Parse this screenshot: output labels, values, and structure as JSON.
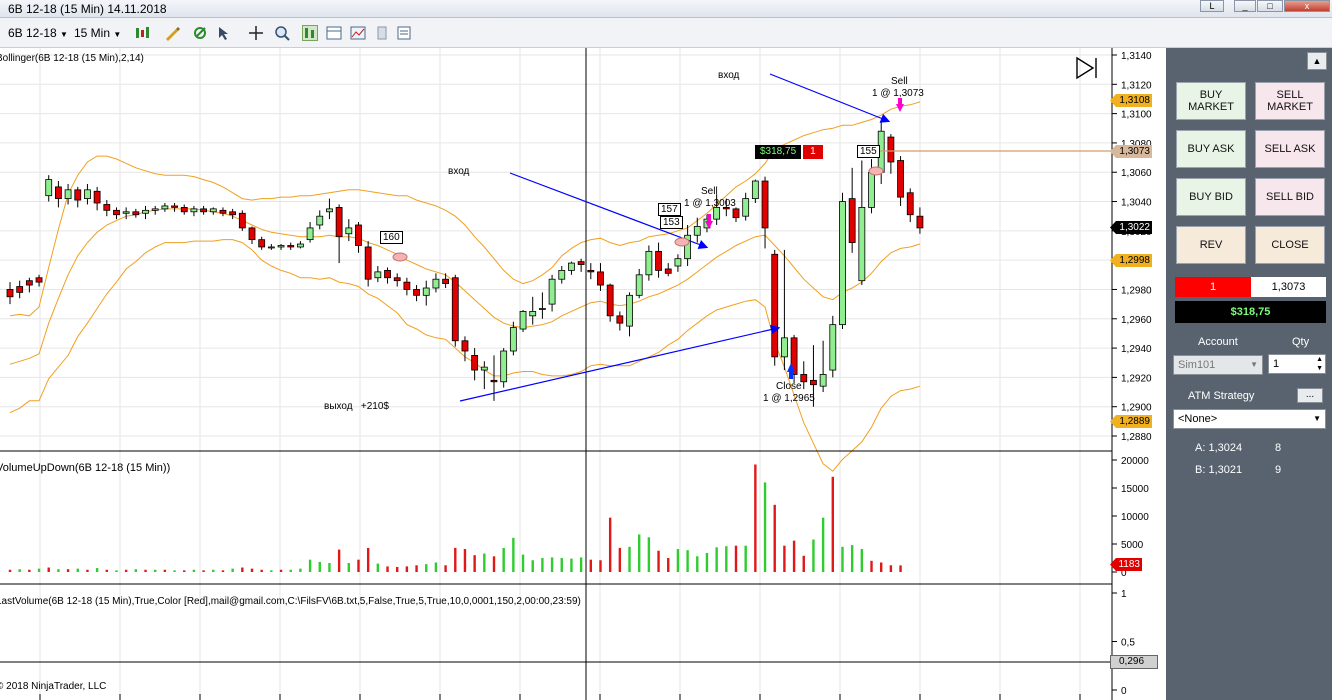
{
  "window": {
    "title": "6B 12-18 (15 Min)  14.11.2018",
    "min_label": "_",
    "max_label": "□",
    "close_label": "x",
    "link_label": "L"
  },
  "toolbar": {
    "instrument": "6B 12-18",
    "interval": "15 Min",
    "icons": [
      "candlestick-icon",
      "pencil-icon",
      "draw-tool-icon",
      "cursor-icon",
      "crosshair-icon",
      "zoom-icon",
      "chart-trader-icon",
      "data-box-icon",
      "properties-icon",
      "template-icon"
    ]
  },
  "chart": {
    "price_labels": [
      "1,3140",
      "1,3120",
      "1,3100",
      "1,3080",
      "1,3060",
      "1,3040",
      "1,3020",
      "1,2980",
      "1,2960",
      "1,2940",
      "1,2920",
      "1,2900",
      "1,2880"
    ],
    "badges": {
      "p1": "1,3108",
      "p2": "1,3073",
      "p3": "1,3022",
      "p4": "1,2998",
      "p5": "1,2889"
    },
    "indicator_label": "Bollinger(6B 12-18 (15 Min),2,14)",
    "volume_label": "VolumeUpDown(6B 12-18 (15 Min))",
    "volume_ticks": [
      "20000",
      "15000",
      "10000",
      "5000",
      "0"
    ],
    "volume_badge": "1183",
    "last_volume_label": "LastVolume(6B 12-18 (15 Min),True,Color [Red],mail@gmail.com,C:\\FilsFV\\6B.txt,5,False,True,5,True,10,0,0001,150,2,00:00,23:59)",
    "lv_ticks": [
      "1",
      "0,5",
      "0"
    ],
    "lv_badge": "0,296",
    "copyright": "© 2018 NinjaTrader, LLC",
    "position_pnl": "$318,75",
    "position_qty": "1",
    "marker_155": "155",
    "marker_157": "157",
    "marker_153": "153",
    "marker_160": "160",
    "annotation_vhod_1": "вход",
    "annotation_vhod_2": "вход",
    "annotation_vyhod": "выход   +210$",
    "sell_1_title": "Sell",
    "sell_1_detail": "1 @ 1,3073",
    "sell_2_title": "Sell",
    "sell_2_detail": "1 @ 1,3003",
    "close_title": "Close",
    "close_detail": "1 @ 1,2965"
  },
  "chart_data": {
    "type": "candlestick",
    "price_axis": {
      "min": 1.288,
      "max": 1.314
    },
    "candles": [
      [
        1.298,
        1.2975,
        1.2985,
        1.297
      ],
      [
        1.2982,
        1.2978,
        1.2986,
        1.2974
      ],
      [
        1.2986,
        1.2983,
        1.2988,
        1.2978
      ],
      [
        1.2988,
        1.2985,
        1.299,
        1.2982
      ],
      [
        1.3044,
        1.3055,
        1.3058,
        1.304
      ],
      [
        1.305,
        1.3042,
        1.3054,
        1.3036
      ],
      [
        1.3042,
        1.3048,
        1.3052,
        1.3038
      ],
      [
        1.3048,
        1.3041,
        1.305,
        1.3036
      ],
      [
        1.3042,
        1.3048,
        1.3052,
        1.3038
      ],
      [
        1.3047,
        1.3039,
        1.305,
        1.3034
      ],
      [
        1.3038,
        1.3034,
        1.3041,
        1.303
      ],
      [
        1.3034,
        1.3031,
        1.3036,
        1.3028
      ],
      [
        1.3032,
        1.3033,
        1.3036,
        1.3028
      ],
      [
        1.3033,
        1.3031,
        1.3035,
        1.3029
      ],
      [
        1.3032,
        1.3034,
        1.3037,
        1.3028
      ],
      [
        1.3034,
        1.3035,
        1.3037,
        1.3031
      ],
      [
        1.3035,
        1.3037,
        1.3039,
        1.3033
      ],
      [
        1.3037,
        1.3036,
        1.3039,
        1.3033
      ],
      [
        1.3036,
        1.3033,
        1.3038,
        1.3031
      ],
      [
        1.3033,
        1.3035,
        1.3037,
        1.303
      ],
      [
        1.3035,
        1.3033,
        1.3037,
        1.3031
      ],
      [
        1.3033,
        1.3035,
        1.3036,
        1.3031
      ],
      [
        1.3034,
        1.3032,
        1.3036,
        1.303
      ],
      [
        1.3033,
        1.3031,
        1.3035,
        1.3028
      ],
      [
        1.3032,
        1.3022,
        1.3034,
        1.302
      ],
      [
        1.3022,
        1.3014,
        1.3023,
        1.3011
      ],
      [
        1.3014,
        1.3009,
        1.3016,
        1.3007
      ],
      [
        1.3009,
        1.3009,
        1.3011,
        1.3007
      ],
      [
        1.3009,
        1.301,
        1.3011,
        1.3007
      ],
      [
        1.301,
        1.3009,
        1.3012,
        1.3007
      ],
      [
        1.3009,
        1.3011,
        1.3013,
        1.3008
      ],
      [
        1.3014,
        1.3022,
        1.3026,
        1.3012
      ],
      [
        1.3024,
        1.303,
        1.3034,
        1.3021
      ],
      [
        1.3033,
        1.3035,
        1.3042,
        1.3028
      ],
      [
        1.3036,
        1.3016,
        1.3038,
        1.2998
      ],
      [
        1.3018,
        1.3022,
        1.3028,
        1.3013
      ],
      [
        1.3024,
        1.301,
        1.3026,
        1.3005
      ],
      [
        1.3009,
        1.2987,
        1.3013,
        1.2982
      ],
      [
        1.2988,
        1.2992,
        1.2996,
        1.2985
      ],
      [
        1.2993,
        1.2988,
        1.2995,
        1.2984
      ],
      [
        1.2988,
        1.2986,
        1.2991,
        1.2982
      ],
      [
        1.2985,
        1.298,
        1.2988,
        1.2976
      ],
      [
        1.298,
        1.2976,
        1.2983,
        1.2972
      ],
      [
        1.2976,
        1.2981,
        1.2986,
        1.2969
      ],
      [
        1.2981,
        1.2987,
        1.2991,
        1.2978
      ],
      [
        1.2987,
        1.2984,
        1.2991,
        1.2981
      ],
      [
        1.2988,
        1.2945,
        1.299,
        1.2941
      ],
      [
        1.2945,
        1.2938,
        1.2948,
        1.2931
      ],
      [
        1.2935,
        1.2925,
        1.294,
        1.2918
      ],
      [
        1.2925,
        1.2927,
        1.2931,
        1.2912
      ],
      [
        1.2918,
        1.2917,
        1.2935,
        1.2904
      ],
      [
        1.2917,
        1.2938,
        1.294,
        1.2913
      ],
      [
        1.2938,
        1.2954,
        1.2958,
        1.2935
      ],
      [
        1.2953,
        1.2965,
        1.2966,
        1.2951
      ],
      [
        1.2962,
        1.2965,
        1.2975,
        1.2956
      ],
      [
        1.2967,
        1.2967,
        1.2978,
        1.296
      ],
      [
        1.297,
        1.2987,
        1.299,
        1.2965
      ],
      [
        1.2987,
        1.2993,
        1.2996,
        1.2984
      ],
      [
        1.2993,
        1.2998,
        1.2999,
        1.299
      ],
      [
        1.2999,
        1.2997,
        1.3001,
        1.2992
      ],
      [
        1.2993,
        1.2992,
        1.2998,
        1.2987
      ],
      [
        1.2992,
        1.2983,
        1.2998,
        1.2979
      ],
      [
        1.2983,
        1.2962,
        1.2984,
        1.2958
      ],
      [
        1.2962,
        1.2957,
        1.2965,
        1.2952
      ],
      [
        1.2955,
        1.2976,
        1.2978,
        1.2948
      ],
      [
        1.2976,
        1.299,
        1.2994,
        1.2974
      ],
      [
        1.299,
        1.3006,
        1.301,
        1.2986
      ],
      [
        1.3006,
        1.2993,
        1.3012,
        1.2988
      ],
      [
        1.2994,
        1.2991,
        1.2998,
        1.2989
      ],
      [
        1.2996,
        1.3001,
        1.3004,
        1.2992
      ],
      [
        1.3001,
        1.3017,
        1.3024,
        1.2996
      ],
      [
        1.3017,
        1.3023,
        1.3029,
        1.3012
      ],
      [
        1.3022,
        1.3028,
        1.3031,
        1.3019
      ],
      [
        1.3028,
        1.3036,
        1.3045,
        1.3024
      ],
      [
        1.3036,
        1.3035,
        1.3042,
        1.303
      ],
      [
        1.3035,
        1.3029,
        1.3036,
        1.3026
      ],
      [
        1.303,
        1.3042,
        1.3046,
        1.3027
      ],
      [
        1.3042,
        1.3054,
        1.3055,
        1.3039
      ],
      [
        1.3054,
        1.3022,
        1.3057,
        1.3008
      ],
      [
        1.3004,
        1.2934,
        1.3007,
        1.2928
      ],
      [
        1.2934,
        1.2947,
        1.3007,
        1.2925
      ],
      [
        1.2947,
        1.2922,
        1.2949,
        1.2916
      ],
      [
        1.2922,
        1.2917,
        1.2931,
        1.2912
      ],
      [
        1.2918,
        1.2915,
        1.2942,
        1.29
      ],
      [
        1.2914,
        1.2922,
        1.2945,
        1.291
      ],
      [
        1.2925,
        1.2956,
        1.2962,
        1.292
      ],
      [
        1.2956,
        1.304,
        1.3046,
        1.2953
      ],
      [
        1.3042,
        1.3012,
        1.3063,
        1.3005
      ],
      [
        1.2986,
        1.3036,
        1.3068,
        1.2983
      ],
      [
        1.3036,
        1.306,
        1.3069,
        1.3032
      ],
      [
        1.306,
        1.3088,
        1.3095,
        1.3052
      ],
      [
        1.3084,
        1.3067,
        1.3086,
        1.3059
      ],
      [
        1.3068,
        1.3043,
        1.3071,
        1.3037
      ],
      [
        1.3046,
        1.3031,
        1.3049,
        1.3026
      ],
      [
        1.303,
        1.3022,
        1.3036,
        1.3018
      ]
    ],
    "bollinger_upper": [
      1.2962,
      1.2963,
      1.2962,
      1.2968,
      1.2995,
      1.3021,
      1.3045,
      1.3058,
      1.3067,
      1.3071,
      1.3071,
      1.3069,
      1.3066,
      1.3063,
      1.3061,
      1.3059,
      1.3058,
      1.3058,
      1.3058,
      1.3057,
      1.3055,
      1.3053,
      1.305,
      1.3046,
      1.3042,
      1.3041,
      1.3042,
      1.3042,
      1.3043,
      1.3043,
      1.3044,
      1.3044,
      1.3045,
      1.3046,
      1.3047,
      1.3048,
      1.3048,
      1.3047,
      1.3046,
      1.3045,
      1.3044,
      1.3044,
      1.3041,
      1.3039,
      1.3037,
      1.3034,
      1.303,
      1.3024,
      1.3016,
      1.3009,
      1.3001,
      1.2993,
      1.2987,
      1.2984,
      1.2986,
      1.299,
      1.2995,
      1.3003,
      1.3008,
      1.3012,
      1.3014,
      1.3015,
      1.3012,
      1.301,
      1.3012,
      1.3013,
      1.3016,
      1.3017,
      1.3018,
      1.302,
      1.3022,
      1.3027,
      1.3032,
      1.3038,
      1.3044,
      1.305,
      1.3054,
      1.3059,
      1.3066,
      1.3076,
      1.3079,
      1.3082,
      1.3085,
      1.3087,
      1.3089,
      1.309,
      1.3092,
      1.3092,
      1.3094,
      1.3096,
      1.3099,
      1.3103,
      1.3105,
      1.3106,
      1.3108
    ],
    "bollinger_mid": [
      1.2929,
      1.2931,
      1.2933,
      1.2936,
      1.2957,
      1.2974,
      1.299,
      1.3003,
      1.3012,
      1.3019,
      1.3024,
      1.3027,
      1.303,
      1.3031,
      1.3033,
      1.3034,
      1.3035,
      1.3035,
      1.3035,
      1.3035,
      1.3034,
      1.3033,
      1.3032,
      1.303,
      1.3027,
      1.3024,
      1.3021,
      1.3019,
      1.3018,
      1.3017,
      1.3016,
      1.3016,
      1.3016,
      1.3017,
      1.3016,
      1.3016,
      1.3015,
      1.3012,
      1.301,
      1.3007,
      1.3004,
      1.3,
      1.2997,
      1.2994,
      1.2992,
      1.299,
      1.2985,
      1.2979,
      1.2973,
      1.2967,
      1.2961,
      1.2957,
      1.2955,
      1.2954,
      1.2955,
      1.2956,
      1.2958,
      1.2962,
      1.2965,
      1.2968,
      1.2971,
      1.2972,
      1.297,
      1.2969,
      1.297,
      1.2972,
      1.2975,
      1.2977,
      1.298,
      1.2983,
      1.2987,
      1.2992,
      1.2997,
      1.3002,
      1.3006,
      1.301,
      1.3013,
      1.3016,
      1.3017,
      1.301,
      1.3003,
      1.2995,
      1.2987,
      1.2981,
      1.2975,
      1.2973,
      1.2978,
      1.2981,
      1.2985,
      1.2991,
      1.2999,
      1.3005,
      1.3008,
      1.3009,
      1.3011
    ],
    "bollinger_lower": [
      1.2896,
      1.2899,
      1.2904,
      1.2904,
      1.2919,
      1.2927,
      1.2935,
      1.2948,
      1.2957,
      1.2967,
      1.2977,
      1.2985,
      1.2994,
      1.2999,
      1.3005,
      1.3009,
      1.3012,
      1.3012,
      1.3012,
      1.3013,
      1.3013,
      1.3013,
      1.3014,
      1.3014,
      1.3012,
      1.3007,
      1.3,
      1.2996,
      1.2993,
      1.2991,
      1.2988,
      1.2988,
      1.2987,
      1.2988,
      1.2985,
      1.2984,
      1.2982,
      1.2977,
      1.2974,
      1.2969,
      1.2964,
      1.2956,
      1.2953,
      1.2949,
      1.2947,
      1.2946,
      1.294,
      1.2934,
      1.293,
      1.2925,
      1.2921,
      1.2921,
      1.2923,
      1.2924,
      1.2924,
      1.2922,
      1.2921,
      1.2921,
      1.2922,
      1.2924,
      1.2928,
      1.2929,
      1.2928,
      1.2928,
      1.2928,
      1.2931,
      1.2934,
      1.2937,
      1.2942,
      1.2946,
      1.2952,
      1.2957,
      1.2962,
      1.2966,
      1.2968,
      1.297,
      1.2972,
      1.2973,
      1.2968,
      1.2944,
      1.2927,
      1.2908,
      1.2889,
      1.2875,
      1.2861,
      1.2856,
      1.2864,
      1.287,
      1.2876,
      1.2886,
      1.2899,
      1.2907,
      1.2911,
      1.2912,
      1.2914
    ],
    "volume_axis": {
      "min": 0,
      "max": 20000
    },
    "volumes": [
      [
        400,
        "d"
      ],
      [
        500,
        "u"
      ],
      [
        400,
        "d"
      ],
      [
        600,
        "u"
      ],
      [
        800,
        "d"
      ],
      [
        500,
        "u"
      ],
      [
        500,
        "d"
      ],
      [
        600,
        "u"
      ],
      [
        400,
        "d"
      ],
      [
        700,
        "u"
      ],
      [
        400,
        "d"
      ],
      [
        300,
        "u"
      ],
      [
        400,
        "d"
      ],
      [
        500,
        "u"
      ],
      [
        400,
        "d"
      ],
      [
        400,
        "u"
      ],
      [
        400,
        "d"
      ],
      [
        300,
        "u"
      ],
      [
        300,
        "d"
      ],
      [
        400,
        "u"
      ],
      [
        300,
        "d"
      ],
      [
        400,
        "u"
      ],
      [
        300,
        "d"
      ],
      [
        600,
        "u"
      ],
      [
        800,
        "d"
      ],
      [
        600,
        "d"
      ],
      [
        400,
        "d"
      ],
      [
        300,
        "u"
      ],
      [
        400,
        "d"
      ],
      [
        400,
        "u"
      ],
      [
        600,
        "u"
      ],
      [
        2200,
        "u"
      ],
      [
        1800,
        "u"
      ],
      [
        1600,
        "u"
      ],
      [
        4000,
        "d"
      ],
      [
        1600,
        "u"
      ],
      [
        2200,
        "d"
      ],
      [
        4300,
        "d"
      ],
      [
        1500,
        "u"
      ],
      [
        1000,
        "d"
      ],
      [
        900,
        "d"
      ],
      [
        1000,
        "d"
      ],
      [
        1200,
        "d"
      ],
      [
        1400,
        "u"
      ],
      [
        1700,
        "u"
      ],
      [
        1200,
        "d"
      ],
      [
        4300,
        "d"
      ],
      [
        4100,
        "d"
      ],
      [
        3000,
        "d"
      ],
      [
        3300,
        "u"
      ],
      [
        2800,
        "d"
      ],
      [
        4300,
        "u"
      ],
      [
        6100,
        "u"
      ],
      [
        3100,
        "u"
      ],
      [
        2100,
        "u"
      ],
      [
        2500,
        "u"
      ],
      [
        2600,
        "u"
      ],
      [
        2500,
        "u"
      ],
      [
        2400,
        "u"
      ],
      [
        2600,
        "u"
      ],
      [
        2200,
        "d"
      ],
      [
        2100,
        "d"
      ],
      [
        9700,
        "d"
      ],
      [
        4300,
        "d"
      ],
      [
        4500,
        "u"
      ],
      [
        6700,
        "u"
      ],
      [
        6200,
        "u"
      ],
      [
        3800,
        "d"
      ],
      [
        2500,
        "d"
      ],
      [
        4100,
        "u"
      ],
      [
        3900,
        "u"
      ],
      [
        2800,
        "u"
      ],
      [
        3400,
        "u"
      ],
      [
        4400,
        "u"
      ],
      [
        4600,
        "u"
      ],
      [
        4700,
        "d"
      ],
      [
        4700,
        "u"
      ],
      [
        19200,
        "d"
      ],
      [
        16000,
        "u"
      ],
      [
        12000,
        "d"
      ],
      [
        4700,
        "d"
      ],
      [
        5600,
        "d"
      ],
      [
        2900,
        "d"
      ],
      [
        5800,
        "u"
      ],
      [
        9700,
        "u"
      ],
      [
        17000,
        "d"
      ],
      [
        4500,
        "u"
      ],
      [
        4800,
        "u"
      ],
      [
        4100,
        "u"
      ],
      [
        2000,
        "d"
      ],
      [
        1700,
        "d"
      ],
      [
        1200,
        "d"
      ],
      [
        1183,
        "d"
      ]
    ],
    "last_volume_axis": {
      "min": 0,
      "max": 1
    },
    "last_volume_value": 0.296
  },
  "panel": {
    "buy_market": "BUY\nMARKET",
    "sell_market": "SELL\nMARKET",
    "buy_ask": "BUY ASK",
    "sell_ask": "SELL ASK",
    "buy_bid": "BUY BID",
    "sell_bid": "SELL BID",
    "rev": "REV",
    "close": "CLOSE",
    "position_qty": "1",
    "position_price": "1,3073",
    "pnl": "$318,75",
    "account_label": "Account",
    "qty_label": "Qty",
    "account_value": "Sim101",
    "qty_value": "1",
    "atm_label": "ATM Strategy",
    "atm_value": "<None>",
    "ask_label": "A: 1,3024",
    "ask_size": "8",
    "bid_label": "B: 1,3021",
    "bid_size": "9",
    "collapse_label": "▲",
    "more_label": "..."
  },
  "colors": {
    "up_candle": "#90ee90",
    "down_candle": "#e00000",
    "bollinger": "#f0a020",
    "vol_up": "#2ecc2e",
    "vol_down": "#e01818",
    "badge_price": "#f0b020",
    "panel_bg": "#58636f"
  }
}
